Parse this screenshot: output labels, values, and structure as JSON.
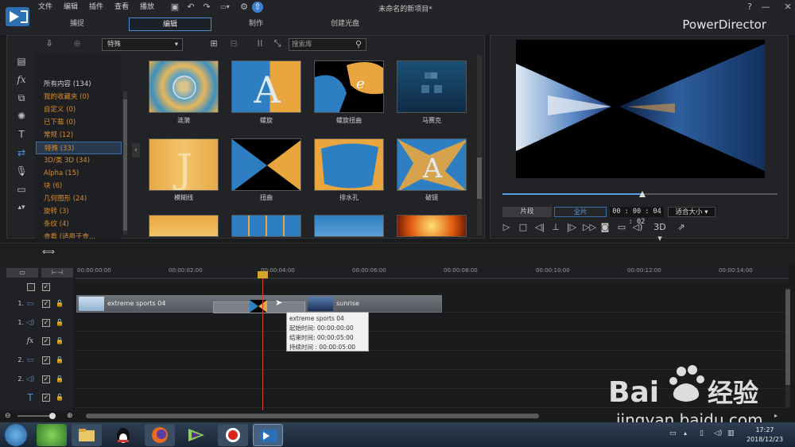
{
  "window": {
    "title": "未命名的新项目*",
    "brand": "PowerDirector",
    "help": "?",
    "minimize": "—",
    "restore": "❐",
    "close": "✕"
  },
  "menu": [
    "文件",
    "编辑",
    "插件",
    "查看",
    "播放"
  ],
  "tabs": [
    {
      "label": "捕捉"
    },
    {
      "label": "编辑"
    },
    {
      "label": "制作"
    },
    {
      "label": "创建光盘"
    }
  ],
  "library": {
    "dropdown": "特殊",
    "search_placeholder": "搜索库",
    "categories": [
      {
        "label": "所有内容 (134)"
      },
      {
        "label": "我的收藏夹 (0)"
      },
      {
        "label": "自定义 (0)"
      },
      {
        "label": "已下载 (0)"
      },
      {
        "label": "常规 (12)"
      },
      {
        "label": "特殊 (33)"
      },
      {
        "label": "3D/类 3D (34)"
      },
      {
        "label": "Alpha (15)"
      },
      {
        "label": "块 (6)"
      },
      {
        "label": "几何图形 (24)"
      },
      {
        "label": "旋转 (3)"
      },
      {
        "label": "条纹 (4)"
      },
      {
        "label": "查看 (适用于查..."
      }
    ],
    "transitions": [
      {
        "label": "涟漪"
      },
      {
        "label": "螺旋"
      },
      {
        "label": "螺旋扭曲"
      },
      {
        "label": "马赛克"
      },
      {
        "label": "模糊线"
      },
      {
        "label": "扭曲"
      },
      {
        "label": "排水孔"
      },
      {
        "label": "破镜"
      }
    ]
  },
  "preview": {
    "mode_clip": "片段",
    "mode_movie": "全片",
    "timecode": "00 : 00 : 04 : 02",
    "fit": "适合大小",
    "view3d": "3D",
    "progress": 0.51
  },
  "timeline": {
    "ruler": [
      "00:00:00:00",
      "00:00:02:00",
      "00:00:04:00",
      "00:00:06:00",
      "00:00:08:00",
      "00:00:10:00",
      "00:00:12:00",
      "00:00:14:00"
    ],
    "tracks": [
      {
        "num": "1.",
        "icon": "video-track-icon"
      },
      {
        "num": "1.",
        "icon": "audio-track-icon"
      },
      {
        "num": "",
        "icon": "fx-track-icon"
      },
      {
        "num": "2.",
        "icon": "video-track-icon"
      },
      {
        "num": "2.",
        "icon": "audio-track-icon"
      },
      {
        "num": "",
        "icon": "title-track-icon"
      }
    ],
    "clips": [
      {
        "name": "extreme sports 04"
      },
      {
        "name": "sunrise"
      }
    ],
    "tooltip": {
      "title": "extreme sports 04",
      "start": "起始时间: 00:00:00:00",
      "end": "结束时间: 00:00:05:00",
      "duration": "持续时间 : 00:00:05:00"
    }
  },
  "taskbar": {
    "time": "17:27",
    "date": "2018/12/23"
  }
}
